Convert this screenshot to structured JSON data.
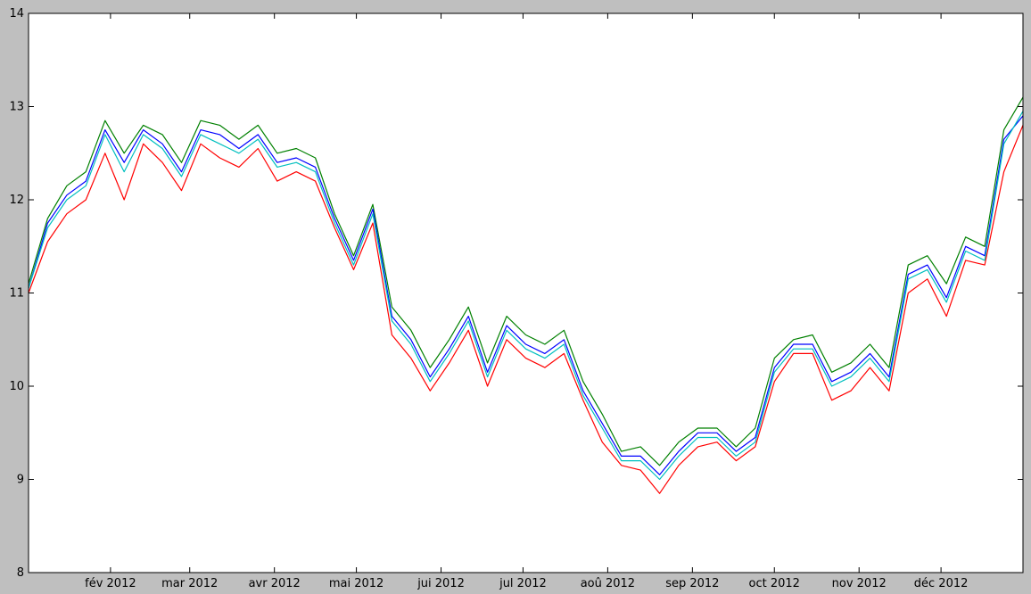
{
  "chart_data": {
    "type": "line",
    "title": "",
    "xlabel": "",
    "ylabel": "",
    "ylim": [
      8,
      14
    ],
    "yticks": [
      8,
      9,
      10,
      11,
      12,
      13,
      14
    ],
    "xlim": [
      "2012-01-02",
      "2012-12-31"
    ],
    "xticks": [
      {
        "date": "2012-02-01",
        "label": "fév 2012"
      },
      {
        "date": "2012-03-01",
        "label": "mar 2012"
      },
      {
        "date": "2012-04-01",
        "label": "avr 2012"
      },
      {
        "date": "2012-05-01",
        "label": "mai 2012"
      },
      {
        "date": "2012-06-01",
        "label": "jui 2012"
      },
      {
        "date": "2012-07-01",
        "label": "jul 2012"
      },
      {
        "date": "2012-08-01",
        "label": "aoû 2012"
      },
      {
        "date": "2012-09-01",
        "label": "sep 2012"
      },
      {
        "date": "2012-10-01",
        "label": "oct 2012"
      },
      {
        "date": "2012-11-01",
        "label": "nov 2012"
      },
      {
        "date": "2012-12-01",
        "label": "déc 2012"
      }
    ],
    "grid": false,
    "x": [
      "2012-01-02",
      "2012-01-09",
      "2012-01-16",
      "2012-01-23",
      "2012-01-30",
      "2012-02-06",
      "2012-02-13",
      "2012-02-20",
      "2012-02-27",
      "2012-03-05",
      "2012-03-12",
      "2012-03-19",
      "2012-03-26",
      "2012-04-02",
      "2012-04-09",
      "2012-04-16",
      "2012-04-23",
      "2012-04-30",
      "2012-05-07",
      "2012-05-14",
      "2012-05-21",
      "2012-05-28",
      "2012-06-04",
      "2012-06-11",
      "2012-06-18",
      "2012-06-25",
      "2012-07-02",
      "2012-07-09",
      "2012-07-16",
      "2012-07-23",
      "2012-07-30",
      "2012-08-06",
      "2012-08-13",
      "2012-08-20",
      "2012-08-27",
      "2012-09-03",
      "2012-09-10",
      "2012-09-17",
      "2012-09-24",
      "2012-10-01",
      "2012-10-08",
      "2012-10-15",
      "2012-10-22",
      "2012-10-29",
      "2012-11-05",
      "2012-11-12",
      "2012-11-19",
      "2012-11-26",
      "2012-12-03",
      "2012-12-10",
      "2012-12-17",
      "2012-12-24",
      "2012-12-31"
    ],
    "series": [
      {
        "color": "#008000",
        "values": [
          11.1,
          11.8,
          12.15,
          12.3,
          12.85,
          12.5,
          12.8,
          12.7,
          12.4,
          12.85,
          12.8,
          12.65,
          12.8,
          12.5,
          12.55,
          12.45,
          11.85,
          11.4,
          11.95,
          10.85,
          10.6,
          10.2,
          10.5,
          10.85,
          10.25,
          10.75,
          10.55,
          10.45,
          10.6,
          10.05,
          9.7,
          9.3,
          9.35,
          9.15,
          9.4,
          9.55,
          9.55,
          9.35,
          9.55,
          10.3,
          10.5,
          10.55,
          10.15,
          10.25,
          10.45,
          10.2,
          11.3,
          11.4,
          11.1,
          11.6,
          11.5,
          12.75,
          13.1
        ]
      },
      {
        "color": "#0000ff",
        "values": [
          11.05,
          11.75,
          12.05,
          12.2,
          12.75,
          12.4,
          12.75,
          12.6,
          12.3,
          12.75,
          12.7,
          12.55,
          12.7,
          12.4,
          12.45,
          12.35,
          11.8,
          11.35,
          11.9,
          10.75,
          10.5,
          10.1,
          10.4,
          10.75,
          10.15,
          10.65,
          10.45,
          10.35,
          10.5,
          9.95,
          9.6,
          9.25,
          9.25,
          9.05,
          9.3,
          9.5,
          9.5,
          9.3,
          9.45,
          10.2,
          10.45,
          10.45,
          10.05,
          10.15,
          10.35,
          10.1,
          11.2,
          11.3,
          10.95,
          11.5,
          11.4,
          12.65,
          12.9
        ]
      },
      {
        "color": "#00bfbf",
        "values": [
          11.05,
          11.7,
          12.0,
          12.15,
          12.7,
          12.3,
          12.7,
          12.55,
          12.25,
          12.7,
          12.6,
          12.5,
          12.65,
          12.35,
          12.4,
          12.3,
          11.75,
          11.3,
          11.85,
          10.7,
          10.45,
          10.05,
          10.35,
          10.7,
          10.1,
          10.6,
          10.4,
          10.3,
          10.45,
          9.9,
          9.55,
          9.2,
          9.2,
          9.0,
          9.25,
          9.45,
          9.45,
          9.25,
          9.4,
          10.15,
          10.4,
          10.4,
          10.0,
          10.1,
          10.3,
          10.05,
          11.15,
          11.25,
          10.9,
          11.45,
          11.35,
          12.6,
          12.95
        ]
      },
      {
        "color": "#ff0000",
        "values": [
          11.0,
          11.55,
          11.85,
          12.0,
          12.5,
          12.0,
          12.6,
          12.4,
          12.1,
          12.6,
          12.45,
          12.35,
          12.55,
          12.2,
          12.3,
          12.2,
          11.7,
          11.25,
          11.75,
          10.55,
          10.3,
          9.95,
          10.25,
          10.6,
          10.0,
          10.5,
          10.3,
          10.2,
          10.35,
          9.85,
          9.4,
          9.15,
          9.1,
          8.85,
          9.15,
          9.35,
          9.4,
          9.2,
          9.35,
          10.05,
          10.35,
          10.35,
          9.85,
          9.95,
          10.2,
          9.95,
          11.0,
          11.15,
          10.75,
          11.35,
          11.3,
          12.3,
          12.8
        ]
      }
    ]
  }
}
